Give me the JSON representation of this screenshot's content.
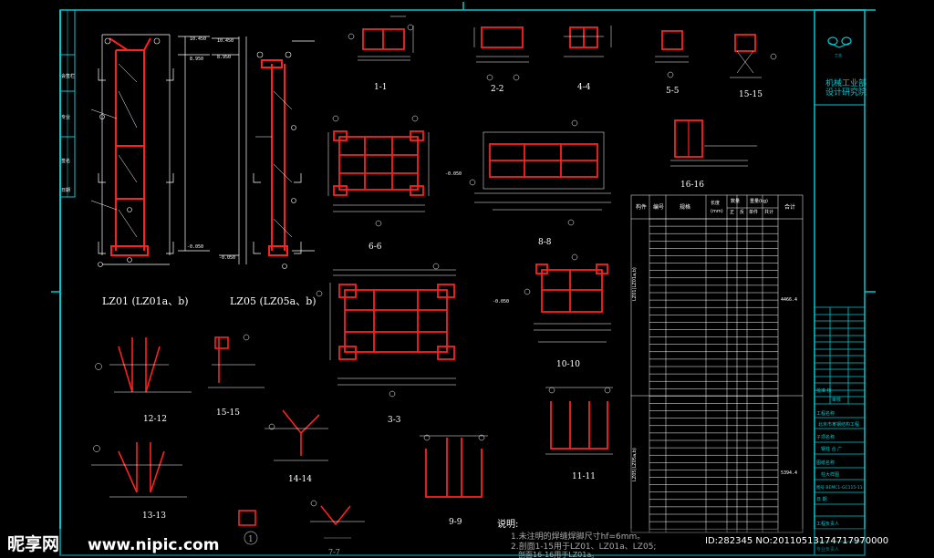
{
  "colors": {
    "background": "#000000",
    "frame": "#00c8d2",
    "member": "#ff2020",
    "line": "#ffffff",
    "accent": "#00ff40",
    "hatch": "#c8c8c8"
  },
  "labels": {
    "lz01": "LZ01 (LZ01a、b)",
    "lz05": "LZ05 (LZ05a、b)",
    "s1": "1-1",
    "s2": "2-2",
    "s4": "4-4",
    "s5": "5-5",
    "s15": "15-15",
    "s16": "16-16",
    "s6": "6-6",
    "s8": "8-8",
    "s3": "3-3",
    "s10": "10-10",
    "s11": "11-11",
    "s9": "9-9",
    "s12": "12-12",
    "s14": "14-14",
    "s13": "13-13",
    "s15b": "15-15",
    "s7": "7-7",
    "s1c": "1"
  },
  "notes": {
    "title": "说明:",
    "line1": "1.未注明的焊缝焊脚尺寸hf=6mm。",
    "line2": "2.剖面1-15用于LZ01、LZ01a、LZ05;",
    "line3": "剖面16-16用于LZ01a。"
  },
  "titleblock": {
    "company_line1": "机械工业部",
    "company_line2": "设计研究院",
    "logo_caption": "工业",
    "r1": "批准  核",
    "r2": "审核",
    "r3": "工程名称",
    "r4": "北京市某钢结构工程",
    "r5": "子项名称",
    "r6": "钢柱 合 广",
    "r7": "图纸名称",
    "r8": "柱大样图",
    "r9": "图号 BEMC1-GC115-11",
    "r10": "日 期",
    "r11": "工程负责人",
    "r12": "专业负责人"
  },
  "table": {
    "col_member": "构件",
    "col_no": "编号",
    "col_spec": "规格",
    "col_len_a": "长度",
    "col_len_b": "(mm)",
    "col_qty": "数量",
    "col_qty_a": "正",
    "col_qty_b": "反",
    "col_wt": "重量(kg)",
    "col_wt_a": "单件",
    "col_wt_b": "共计",
    "col_total": "合计",
    "group1": "LZ01(LZ01a,b)",
    "group2": "LZ05(LZ05a,b)",
    "sum1": "4466.4",
    "sum2": "5394.4"
  },
  "left_strip": [
    "会签栏",
    "专业",
    "签名",
    "日期"
  ],
  "watermark": {
    "brand": "昵享网",
    "url": "www.nipic.com",
    "id": "ID:282345  NO:20110513174717970000"
  }
}
